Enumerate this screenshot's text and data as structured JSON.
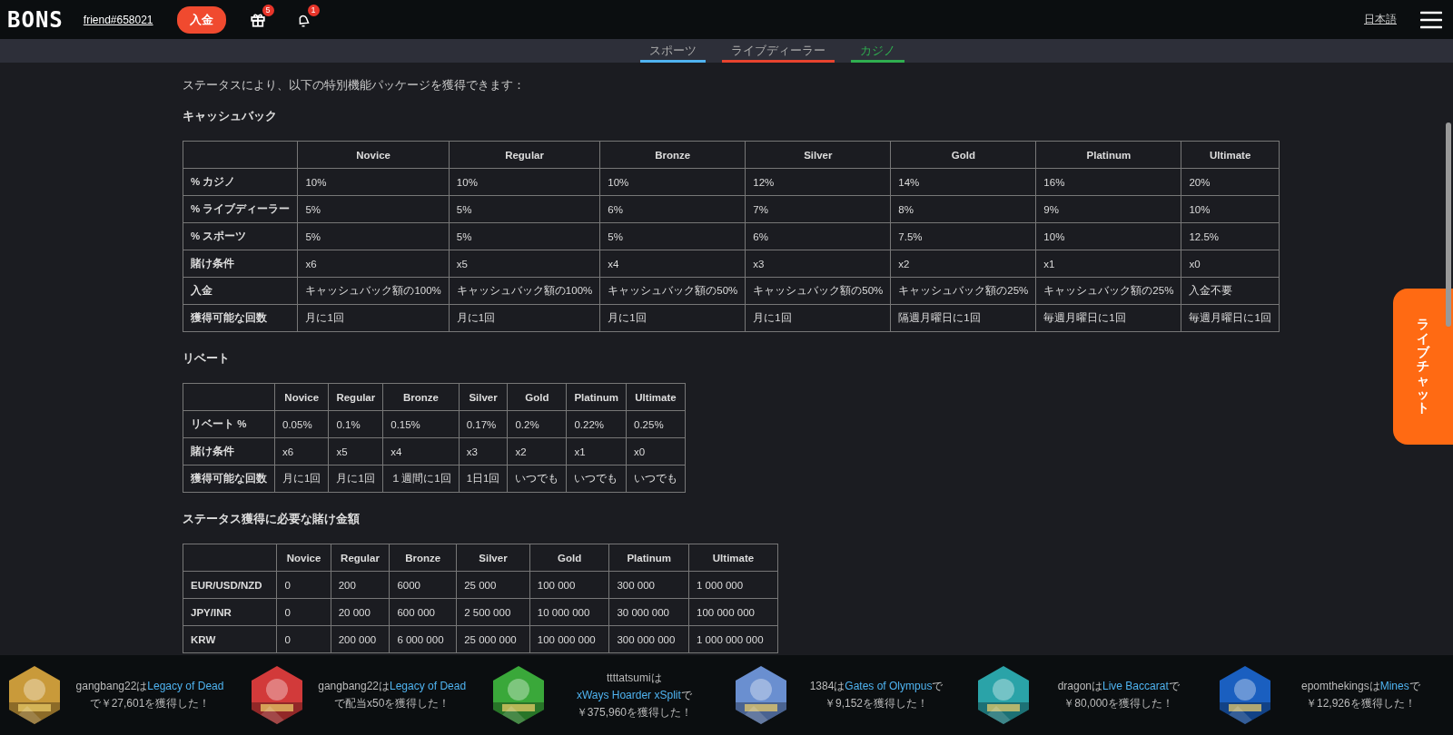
{
  "header": {
    "logo": "BONS",
    "username": "friend#658021",
    "deposit_button": "入金",
    "gift_badge": "5",
    "notification_badge": "1",
    "language": "日本語"
  },
  "subnav": [
    {
      "label": "スポーツ",
      "selected": false,
      "color": "#4fb3f0"
    },
    {
      "label": "ライブディーラー",
      "selected": false,
      "color": "#e8432e"
    },
    {
      "label": "カジノ",
      "selected": true,
      "color": "#2fae4f"
    }
  ],
  "intro": "ステータスにより、以下の特別機能パッケージを獲得できます：",
  "sections": [
    {
      "heading": "キャッシュバック",
      "table": {
        "columns": [
          "",
          "Novice",
          "Regular",
          "Bronze",
          "Silver",
          "Gold",
          "Platinum",
          "Ultimate"
        ],
        "rows": [
          [
            "% カジノ",
            "10%",
            "10%",
            "10%",
            "12%",
            "14%",
            "16%",
            "20%"
          ],
          [
            "% ライブディーラー",
            "5%",
            "5%",
            "6%",
            "7%",
            "8%",
            "9%",
            "10%"
          ],
          [
            "% スポーツ",
            "5%",
            "5%",
            "5%",
            "6%",
            "7.5%",
            "10%",
            "12.5%"
          ],
          [
            "賭け条件",
            "x6",
            "x5",
            "x4",
            "x3",
            "x2",
            "x1",
            "x0"
          ],
          [
            "入金",
            "キャッシュバック額の100%",
            "キャッシュバック額の100%",
            "キャッシュバック額の50%",
            "キャッシュバック額の50%",
            "キャッシュバック額の25%",
            "キャッシュバック額の25%",
            "入金不要"
          ],
          [
            "獲得可能な回数",
            "月に1回",
            "月に1回",
            "月に1回",
            "月に1回",
            "隔週月曜日に1回",
            "毎週月曜日に1回",
            "毎週月曜日に1回"
          ]
        ]
      }
    },
    {
      "heading": "リベート",
      "table": {
        "columns": [
          "",
          "Novice",
          "Regular",
          "Bronze",
          "Silver",
          "Gold",
          "Platinum",
          "Ultimate"
        ],
        "rows": [
          [
            "リベート %",
            "0.05%",
            "0.1%",
            "0.15%",
            "0.17%",
            "0.2%",
            "0.22%",
            "0.25%"
          ],
          [
            "賭け条件",
            "x6",
            "x5",
            "x4",
            "x3",
            "x2",
            "x1",
            "x0"
          ],
          [
            "獲得可能な回数",
            "月に1回",
            "月に1回",
            "１週間に1回",
            "1日1回",
            "いつでも",
            "いつでも",
            "いつでも"
          ]
        ]
      }
    },
    {
      "heading": "ステータス獲得に必要な賭け金額",
      "table": {
        "columns": [
          "",
          "Novice",
          "Regular",
          "Bronze",
          "Silver",
          "Gold",
          "Platinum",
          "Ultimate"
        ],
        "rows": [
          [
            "EUR/USD/NZD",
            "0",
            "200",
            "6000",
            "25 000",
            "100 000",
            "300 000",
            "1 000 000"
          ],
          [
            "JPY/INR",
            "0",
            "20 000",
            "600 000",
            "2 500 000",
            "10 000 000",
            "30 000 000",
            "100 000 000"
          ],
          [
            "KRW",
            "0",
            "200 000",
            "6 000 000",
            "25 000 000",
            "100 000 000",
            "300 000 000",
            "1 000 000 000"
          ]
        ]
      }
    }
  ],
  "live_chat": "ライブチャット",
  "ticker": [
    {
      "prefix": "gangbang22は",
      "game": "Legacy of Dead",
      "suffix": "で￥27,601を獲得した！"
    },
    {
      "prefix": "gangbang22は",
      "game": "Legacy of Dead",
      "suffix": "で配当x50を獲得した！"
    },
    {
      "prefix": "ttttatsumiは",
      "game": "xWays Hoarder xSplit",
      "suffix": "で￥375,960を獲得した！"
    },
    {
      "prefix": "1384は",
      "game": "Gates of Olympus",
      "suffix": "で￥9,152を獲得した！"
    },
    {
      "prefix": "dragonは",
      "game": "Live Baccarat",
      "suffix": "で￥80,000を獲得した！"
    },
    {
      "prefix": "epomthekingsは",
      "game": "Mines",
      "suffix": "で￥12,926を獲得した！"
    }
  ]
}
